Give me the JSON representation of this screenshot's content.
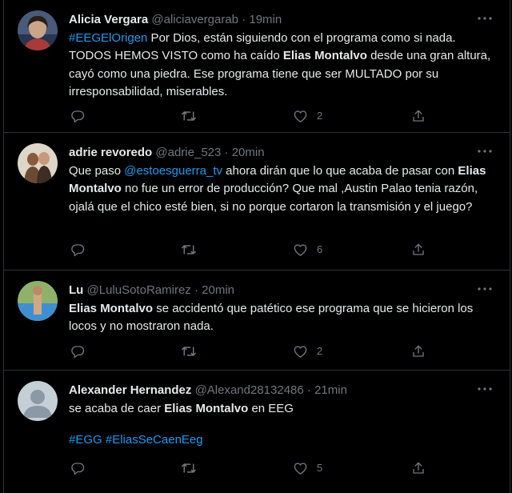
{
  "tweets": [
    {
      "name": "Alicia Vergara",
      "handle": "@aliciavergarab",
      "dot": "·",
      "time": "19min",
      "text": [
        {
          "t": "#EEGElOrigen",
          "k": "hashtag"
        },
        {
          "t": " Por Dios, están siguiendo con el programa como si nada. TODOS HEMOS VISTO como ha caído "
        },
        {
          "t": "Elias Montalvo",
          "k": "bold"
        },
        {
          "t": " desde una gran altura, cayó como una piedra.  Ese programa tiene que ser MULTADO por su irresponsabilidad, miserables."
        }
      ],
      "likes": "2",
      "avatar": "avatar-alicia"
    },
    {
      "name": "adrie revoredo",
      "handle": "@adrie_523",
      "dot": "·",
      "time": "20min",
      "text": [
        {
          "t": "Que paso "
        },
        {
          "t": "@estoesguerra_tv",
          "k": "mention"
        },
        {
          "t": " ahora dirán que lo que acaba de pasar con "
        },
        {
          "t": "Elias Montalvo",
          "k": "bold"
        },
        {
          "t": " no fue un error de producción? Que mal ,Austin Palao tenia razón, ojalá que el chico esté bien, si no porque cortaron la transmisión y el juego?"
        }
      ],
      "likes": "6",
      "avatar": "avatar-adrie"
    },
    {
      "name": "Lu",
      "handle": "@LuluSotoRamirez",
      "dot": "·",
      "time": "20min",
      "text": [
        {
          "t": "Elias Montalvo",
          "k": "bold"
        },
        {
          "t": " se accidentó que patético ese programa que se hicieron los locos y no mostraron nada."
        }
      ],
      "likes": "2",
      "avatar": "avatar-lu"
    },
    {
      "name": "Alexander Hernandez",
      "handle": "@Alexand28132486",
      "dot": "·",
      "time": "21min",
      "text": [
        {
          "t": "se acaba de caer "
        },
        {
          "t": "Elias Montalvo",
          "k": "bold"
        },
        {
          "t": " en EEG"
        }
      ],
      "hashtags": "#EGG #EliasSeCaenEeg",
      "likes": "5",
      "avatar": "avatar-default"
    }
  ],
  "icons": {
    "reply": "reply-icon",
    "retweet": "retweet-icon",
    "like": "like-icon",
    "share": "share-icon",
    "more": "more-icon"
  },
  "colors": {
    "background": "#000000",
    "text": "#e7e9ea",
    "secondary": "#71767b",
    "accent": "#1d9bf0",
    "border": "#2f3336"
  }
}
